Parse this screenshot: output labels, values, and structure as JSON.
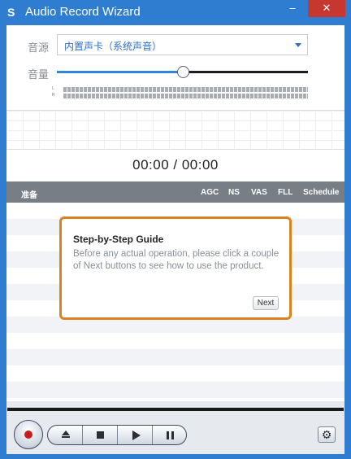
{
  "window": {
    "title": "Audio Record Wizard",
    "logo": "S"
  },
  "titlebar": {
    "minimize": "–",
    "close": "✕"
  },
  "settings": {
    "source_label": "音源",
    "source_value": "内置声卡（系统声音）",
    "volume_label": "音量",
    "volume_level_fraction": 0.5,
    "meter_left_letter": "L",
    "meter_right_letter": "R"
  },
  "timer": {
    "text": "00:00 / 00:00"
  },
  "list": {
    "columns": [
      "准备",
      "AGC",
      "NS",
      "VAS",
      "FLL",
      "Schedule"
    ],
    "rows": []
  },
  "guide": {
    "title": "Step-by-Step Guide",
    "text": "Before any actual operation, please click a couple of Next buttons to see how to use the product.",
    "next_label": "Next"
  },
  "controls": {
    "record": "record-icon",
    "eject": "eject-icon",
    "stop": "stop-icon",
    "play": "play-icon",
    "pause": "pause-icon",
    "settings_glyph": "⚙"
  },
  "colors": {
    "titlebar": "#2f7dd0",
    "close": "#c7372f",
    "guide_border": "#d9821f",
    "record": "#c71d1d",
    "header": "#777e86"
  }
}
